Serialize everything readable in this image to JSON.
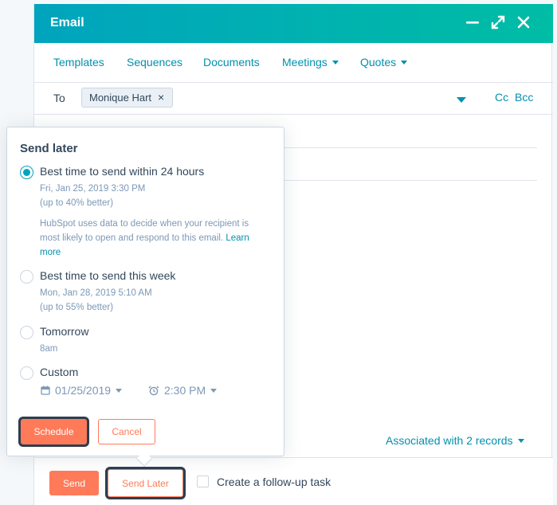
{
  "header": {
    "title": "Email",
    "icons": [
      "minimize-icon",
      "expand-icon",
      "close-icon"
    ]
  },
  "toolbar": {
    "templates": "Templates",
    "sequences": "Sequences",
    "documents": "Documents",
    "meetings": "Meetings",
    "quotes": "Quotes"
  },
  "recipients": {
    "to_label": "To",
    "chip_name": "Monique Hart",
    "chip_remove": "×",
    "cc": "Cc",
    "bcc": "Bcc"
  },
  "send_later_popover": {
    "title": "Send later",
    "options": [
      {
        "label": "Best time to send within 24 hours",
        "date": "Fri, Jan 25, 2019 3:30 PM",
        "improvement": "(up to 40% better)",
        "selected": true
      },
      {
        "label": "Best time to send this week",
        "date": "Mon, Jan 28, 2019 5:10 AM",
        "improvement": "(up to 55% better)",
        "selected": false
      },
      {
        "label": "Tomorrow",
        "date": "8am",
        "selected": false
      },
      {
        "label": "Custom",
        "selected": false
      }
    ],
    "description": "HubSpot uses data to decide when your recipient is most likely to open and respond to this email.",
    "learn_more": "Learn more",
    "custom_date": "01/25/2019",
    "custom_time": "2:30 PM",
    "schedule_label": "Schedule",
    "cancel_label": "Cancel"
  },
  "associated": "Associated with 2 records",
  "footer": {
    "send_label": "Send",
    "send_later_label": "Send Later",
    "follow_up_label": "Create a follow-up task"
  },
  "colors": {
    "header_start": "#00a4bd",
    "header_end": "#00bda5",
    "link": "#0091ae",
    "primary_button": "#ff7a59",
    "text": "#33475b",
    "muted": "#7c98b6",
    "focus_outline": "#2d3e50"
  }
}
